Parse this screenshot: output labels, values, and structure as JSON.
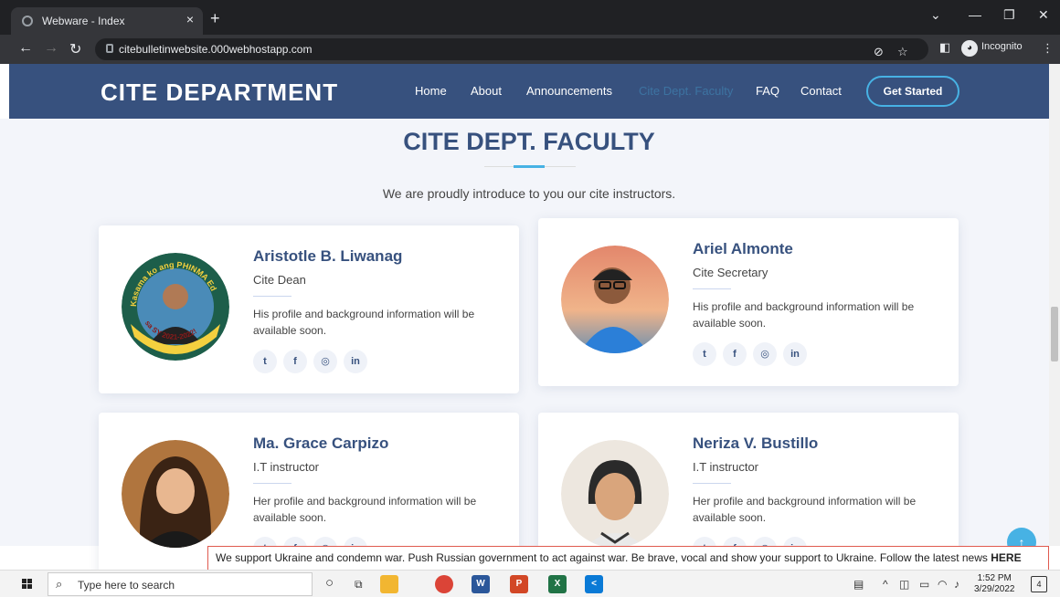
{
  "browser": {
    "tab_title": "Webware - Index",
    "tab_close": "×",
    "new_tab": "+",
    "url": "citebulletinwebsite.000webhostapp.com",
    "incognito_label": "Incognito",
    "win_minimize": "—",
    "win_restore": "❐",
    "win_close": "✕",
    "chevron": "⌄"
  },
  "site": {
    "logo": "CITE DEPARTMENT",
    "nav": [
      "Home",
      "About",
      "Announcements",
      "Cite Dept. Faculty",
      "FAQ",
      "Contact"
    ],
    "cta": "Get Started"
  },
  "section": {
    "title": "CITE DEPT. FACULTY",
    "subtitle": "We are proudly introduce to you our cite instructors."
  },
  "faculty": [
    {
      "name": "Aristotle B. Liwanag",
      "role": "Cite Dean",
      "desc": "His profile and background information will be available soon.",
      "badge_top": "Kasama ko ang PHINMA Ed",
      "badge_bottom": "sa SY 2021-2022!"
    },
    {
      "name": "Ariel Almonte",
      "role": "Cite Secretary",
      "desc": "His profile and background information will be available soon."
    },
    {
      "name": "Ma. Grace Carpizo",
      "role": "I.T instructor",
      "desc": "Her profile and background information will be available soon."
    },
    {
      "name": "Neriza V. Bustillo",
      "role": "I.T instructor",
      "desc": "Her profile and background information will be available soon."
    }
  ],
  "banner": {
    "text": "We support Ukraine and condemn war. Push Russian government to act against war. Be brave, vocal and show your support to Ukraine. Follow the latest news ",
    "link": "HERE"
  },
  "taskbar": {
    "search_placeholder": "Type here to search",
    "time": "1:52 PM",
    "date": "3/29/2022",
    "notification_count": "4"
  },
  "colors": {
    "accent": "#47b2e4",
    "header": "#37517e",
    "section_bg": "#f3f5fa"
  }
}
